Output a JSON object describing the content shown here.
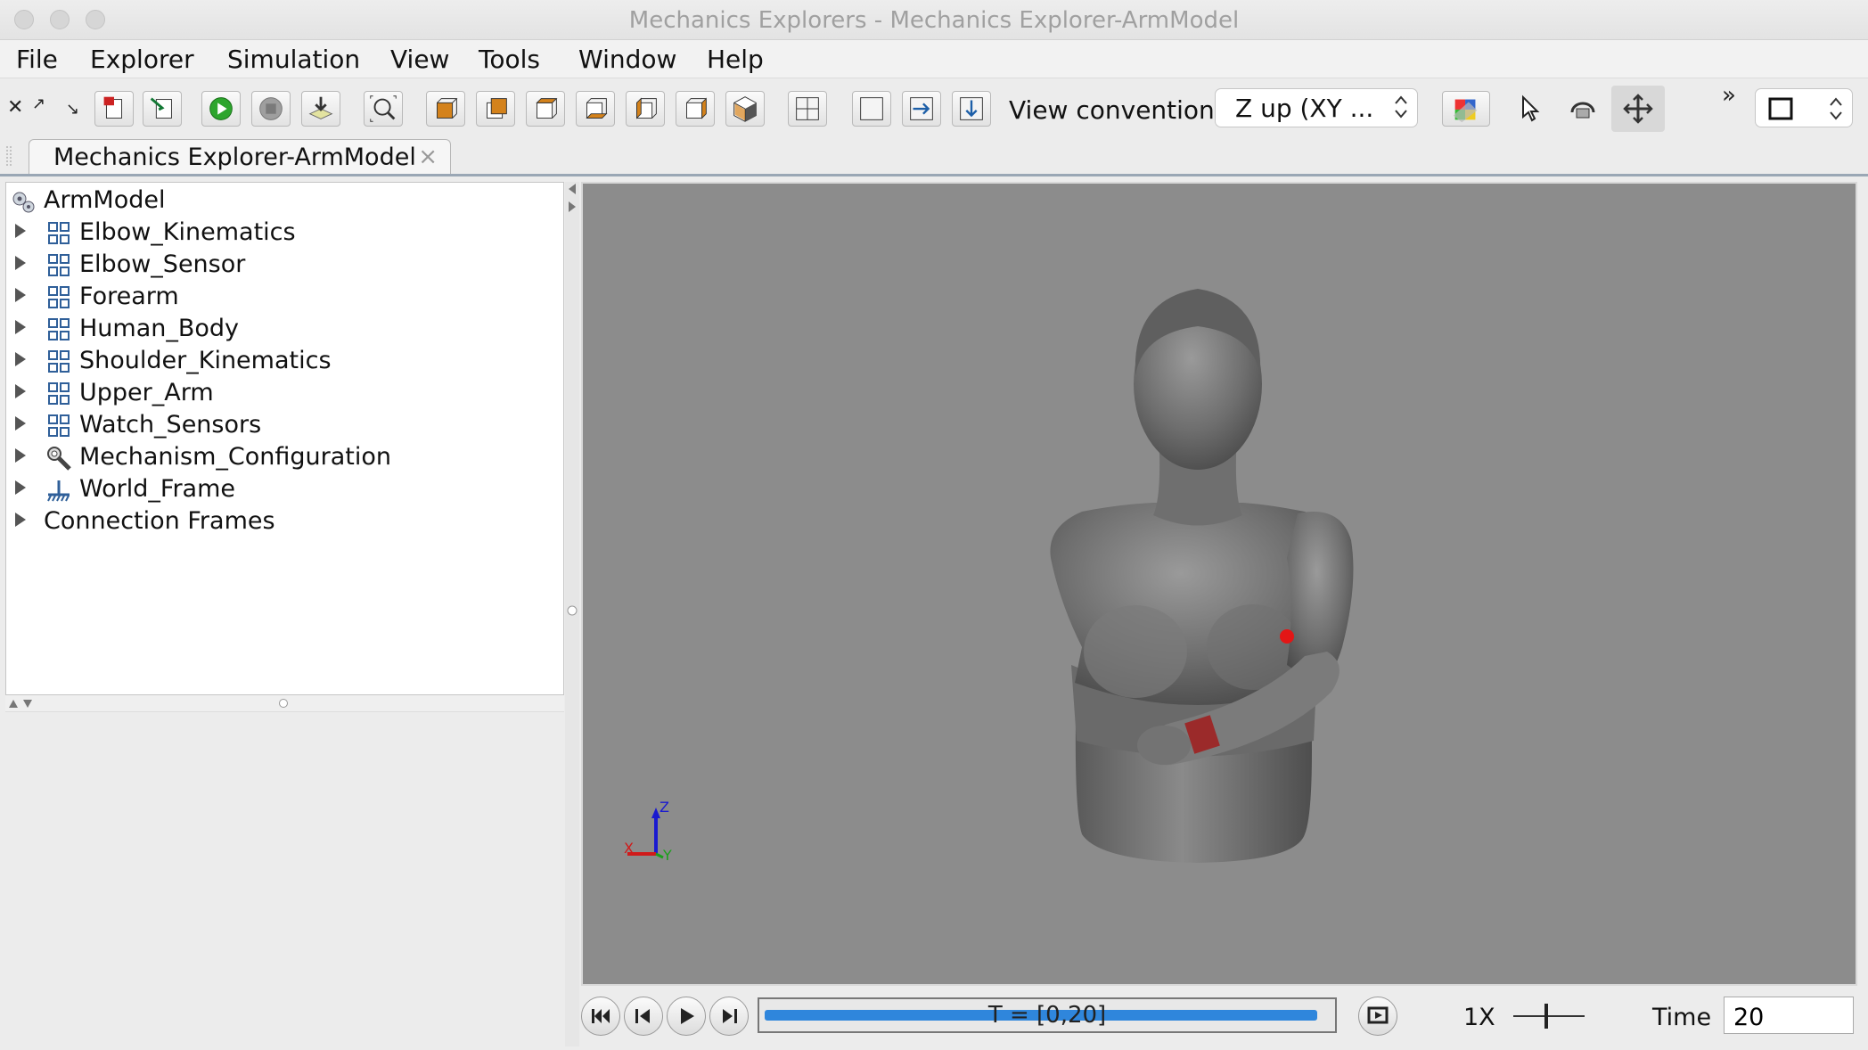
{
  "window": {
    "title": "Mechanics Explorers - Mechanics Explorer-ArmModel"
  },
  "menu": [
    "File",
    "Explorer",
    "Simulation",
    "View",
    "Tools",
    "Window",
    "Help"
  ],
  "toolbar": {
    "view_convention_label": "View convention:",
    "view_convention_value": "Z up (XY ...",
    "overflow_glyph": "»"
  },
  "tab": {
    "label": "Mechanics Explorer-ArmModel",
    "close_glyph": "×"
  },
  "tree": {
    "root": "ArmModel",
    "items": [
      {
        "label": "Elbow_Kinematics",
        "icon": "subsystem-icon"
      },
      {
        "label": "Elbow_Sensor",
        "icon": "subsystem-icon"
      },
      {
        "label": "Forearm",
        "icon": "subsystem-icon"
      },
      {
        "label": "Human_Body",
        "icon": "subsystem-icon"
      },
      {
        "label": "Shoulder_Kinematics",
        "icon": "subsystem-icon"
      },
      {
        "label": "Upper_Arm",
        "icon": "subsystem-icon"
      },
      {
        "label": "Watch_Sensors",
        "icon": "subsystem-icon"
      },
      {
        "label": "Mechanism_Configuration",
        "icon": "wrench-icon"
      },
      {
        "label": "World_Frame",
        "icon": "ground-icon"
      },
      {
        "label": "Connection Frames",
        "icon": ""
      }
    ]
  },
  "viewport": {
    "axes": {
      "x": "X",
      "y": "Y",
      "z": "Z"
    },
    "colors": {
      "background": "#8c8c8c",
      "marker_sphere": "#e31616",
      "marker_cube": "#9b2a2a"
    }
  },
  "playback": {
    "range_label": "T = [0,20]",
    "progress": 1.0,
    "speed": "1X",
    "time_label": "Time",
    "time_value": "20"
  }
}
